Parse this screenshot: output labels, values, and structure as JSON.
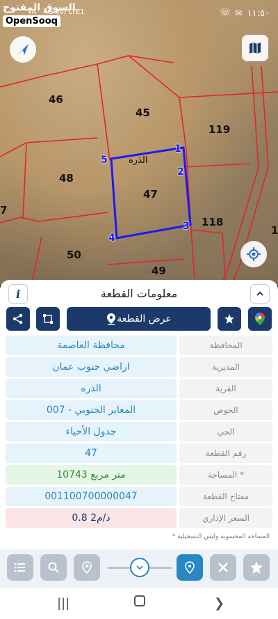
{
  "status": {
    "time": "١١:٥٠",
    "signal": "4G  Vo)  LTE1",
    "speed": "٧A"
  },
  "brand": {
    "arabic": "السوق المفتوح",
    "latin": "OpenSooq"
  },
  "map": {
    "parcels": [
      "46",
      "45",
      "119",
      "48",
      "47",
      "118",
      "50",
      "49",
      "7",
      "1"
    ],
    "corners": [
      "1",
      "2",
      "3",
      "4",
      "5"
    ],
    "village_label": "الذره"
  },
  "sheet": {
    "title": "معلومات القطعة",
    "info_label": "i",
    "show_parcel": "عرض القطعة"
  },
  "rows": [
    {
      "label": "المحافظة",
      "value": "محافظة العاصمة"
    },
    {
      "label": "المديرية",
      "value": "اراضي جنوب عمان"
    },
    {
      "label": "القرية",
      "value": "الذره"
    },
    {
      "label": "الحوض",
      "value": "المغاير الجنوبي - 007"
    },
    {
      "label": "الحي",
      "value": "جدول الأحياء"
    },
    {
      "label": "رقم القطعة",
      "value": "47"
    },
    {
      "label": "المساحة *",
      "value": "10743   متر مربع"
    },
    {
      "label": "مفتاح القطعة",
      "value": "001100700000047"
    },
    {
      "label": "السعر الإداري",
      "value": "0.8 د/م2"
    }
  ],
  "note": "* المساحة المحسوبة وليس التسجيلية",
  "colors": {
    "primary": "#1b3a6b",
    "accent": "#2a86c5",
    "area_bg": "#e6f6e6",
    "price_bg": "#fbe4e6",
    "parcel_line": "#e0262a",
    "selected": "#1a1af0"
  }
}
